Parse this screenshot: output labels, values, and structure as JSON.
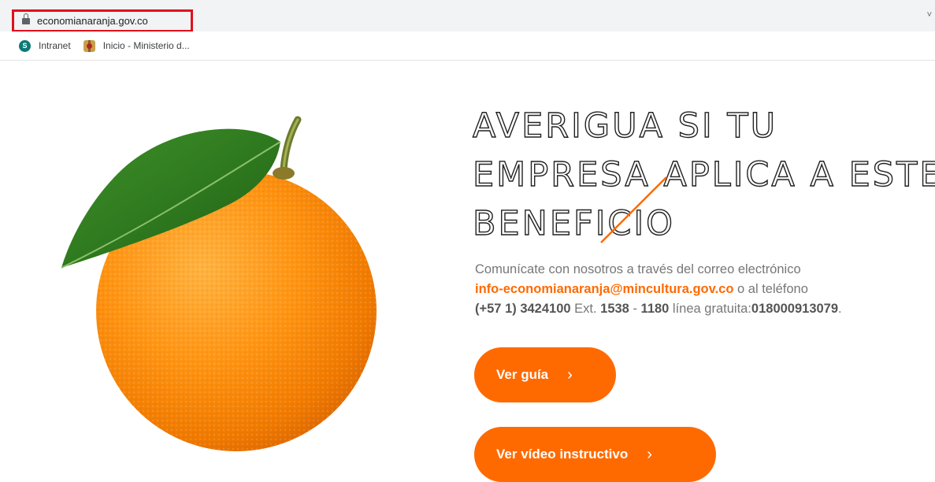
{
  "browser": {
    "url": "economianaranja.gov.co",
    "right_glyph": "˅",
    "bookmarks": [
      {
        "label": "Intranet",
        "icon": "sharepoint-icon",
        "icon_letter": "S"
      },
      {
        "label": "Inicio - Ministerio d...",
        "icon": "crest-icon"
      }
    ]
  },
  "hero": {
    "headline_lines": [
      "Averigua si tu",
      "empresa aplica a este",
      "beneficio"
    ],
    "contact": {
      "intro": "Comunícate con nosotros a través del correo electrónico",
      "email": "info-economianaranja@mincultura.gov.co",
      "phone_connector": " o al teléfono",
      "phone": "(+57 1) 3424100",
      "ext_label": " Ext. ",
      "ext1": "1538",
      "ext_sep": " - ",
      "ext2": "1180",
      "line_label": " línea gratuita:",
      "toll_free": "018000913079",
      "end": "."
    },
    "buttons": {
      "guide_label": "Ver guía",
      "video_label": "Ver vídeo instructivo",
      "chevron": "›"
    }
  },
  "colors": {
    "accent": "#ff6a00",
    "highlight_border": "#e0101d"
  }
}
